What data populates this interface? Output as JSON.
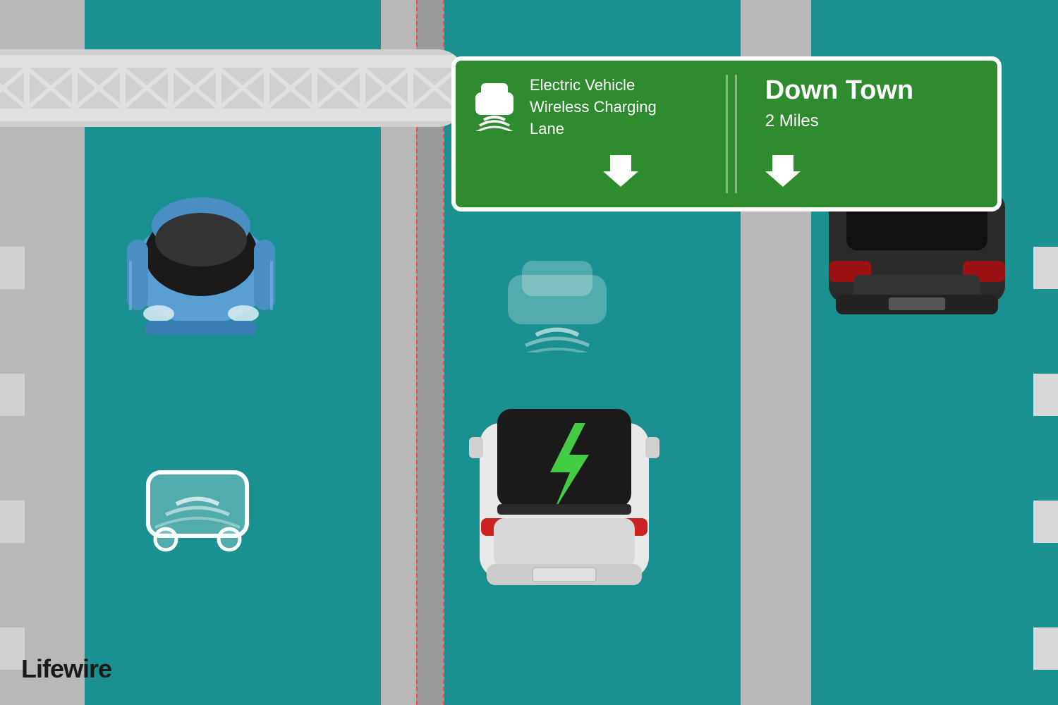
{
  "scene": {
    "title": "Electric Vehicle Wireless Charging Lane Illustration",
    "brand": "Lifewire"
  },
  "highway_sign": {
    "background_color": "#2e8b2e",
    "border_color": "#ffffff",
    "left_section": {
      "label": "EV wireless charging icon"
    },
    "middle_section": {
      "main_text": "Electric Vehicle\nWireless Charging\nLane",
      "arrow_label": "down arrow"
    },
    "right_section": {
      "title": "Down Town",
      "subtitle": "2 Miles",
      "arrow_label": "down arrow"
    }
  },
  "road": {
    "left_lane_color": "#1a9090",
    "middle_lane_color": "#1a9090",
    "right_lane_color": "#1a9090",
    "background_color": "#b8b8b8"
  },
  "vehicles": {
    "blue_car": {
      "label": "Blue electric car, left lane, moving"
    },
    "white_ev": {
      "label": "White electric vehicle, middle lane, charging"
    },
    "dark_car": {
      "label": "Dark SUV, right lane"
    }
  },
  "bridge": {
    "label": "Overhead gantry bridge structure"
  }
}
